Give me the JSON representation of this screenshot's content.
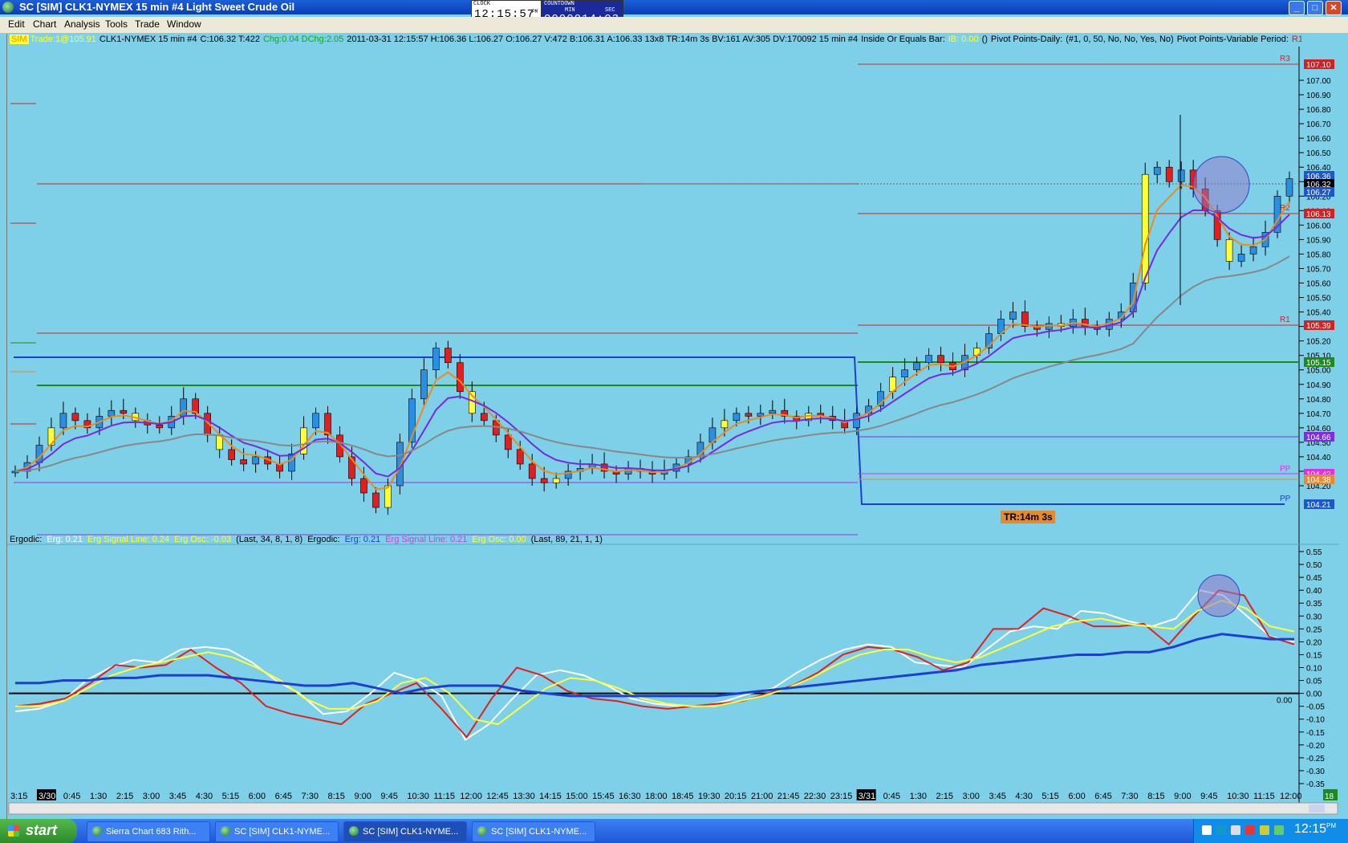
{
  "window": {
    "title": "SC [SIM] CLK1-NYMEX  15 min  #4  Light Sweet Crude Oil"
  },
  "clock": {
    "label": "CLOCK",
    "value": "12:15:57",
    "ampm": "PM"
  },
  "countdown": {
    "label": "COUNTDOWN",
    "min_label": "MIN",
    "sec_label": "SEC",
    "value": "0000014:03"
  },
  "menu": [
    "Edit",
    "Chart",
    "Analysis",
    "Tools",
    "Trade",
    "Window"
  ],
  "info_bar": {
    "sim": "SIM",
    "trade": "Trade:1@105.91",
    "symbol": "CLK1-NYMEX  15 min  #4",
    "ohlc": "C:106.32 T:422",
    "chg": "Chg:0.04 DChg:2.05",
    "detail": "2011-03-31 12:15:57 H:106.36 L:106.27 O:106.27 V:472 B:106.31 A:106.33 13x8 TR:14m 3s BV:161 AV:305 DV:170092 15 min  #4",
    "inside": "Inside Or Equals Bar:",
    "ib": "IB: 0.00",
    "parens": "()",
    "pivots_daily": "Pivot Points-Daily:",
    "pivots_params": "(#1, 0, 50, No, No, Yes, No)",
    "pivots_variable": "Pivot Points-Variable Period:",
    "r1_flag": "R1"
  },
  "ergodic_bar": {
    "ergodic1": "Ergodic:",
    "erg1": "Erg: 0.21",
    "sig1": "Erg Signal Line: 0.24",
    "osc1": "Erg Osc: -0.03",
    "params1": "(Last, 34, 8, 1, 8)",
    "ergodic2": "Ergodic:",
    "erg2": "Erg: 0.21",
    "sig2": "Erg Signal Line: 0.21",
    "osc2": "Erg Osc: 0.00",
    "params2": "(Last, 89, 21, 1, 1)"
  },
  "price_scale": [
    "107.00",
    "106.90",
    "106.80",
    "106.70",
    "106.60",
    "106.50",
    "106.40",
    "106.30",
    "106.20",
    "106.10",
    "106.00",
    "105.90",
    "105.80",
    "105.70",
    "105.60",
    "105.50",
    "105.40",
    "105.30",
    "105.20",
    "105.10",
    "105.00",
    "104.90",
    "104.80",
    "104.70",
    "104.60",
    "104.50",
    "104.40",
    "104.30",
    "104.20"
  ],
  "price_tags": [
    {
      "label": "107.10",
      "color": "#d42020"
    },
    {
      "label": "106.36",
      "color": "#1d57d0"
    },
    {
      "label": "106.32",
      "color": "#000000"
    },
    {
      "label": "106.27",
      "color": "#1d57d0"
    },
    {
      "label": "106.13",
      "color": "#d42020"
    },
    {
      "label": "105.39",
      "color": "#d42020"
    },
    {
      "label": "105.15",
      "color": "#1d8a1d"
    },
    {
      "label": "104.66",
      "color": "#7d2fe0"
    },
    {
      "label": "104.42",
      "color": "#e030e0"
    },
    {
      "label": "104.38",
      "color": "#e68a2e"
    },
    {
      "label": "104.21",
      "color": "#1d57d0"
    }
  ],
  "pivot_labels": {
    "r3": "R3",
    "r2": "R2",
    "r1": "R1",
    "pp_magenta": "PP",
    "pp_blue": "PP"
  },
  "tr_label": "TR:14m 3s",
  "osc_scale": [
    "0.55",
    "0.50",
    "0.45",
    "0.40",
    "0.35",
    "0.30",
    "0.25",
    "0.20",
    "0.15",
    "0.10",
    "0.05",
    "0.00",
    "-0.05",
    "-0.10",
    "-0.15",
    "-0.20",
    "-0.25",
    "-0.30",
    "-0.35"
  ],
  "osc_zero_tag": "0.00",
  "time_axis": [
    "3:15",
    "3/30",
    "0:45",
    "1:30",
    "2:15",
    "3:00",
    "3:45",
    "4:30",
    "5:15",
    "6:00",
    "6:45",
    "7:30",
    "8:15",
    "9:00",
    "9:45",
    "10:30",
    "11:15",
    "12:00",
    "12:45",
    "13:30",
    "14:15",
    "15:00",
    "15:45",
    "16:30",
    "18:00",
    "18:45",
    "19:30",
    "20:15",
    "21:00",
    "21:45",
    "22:30",
    "23:15",
    "3/31",
    "0:45",
    "1:30",
    "2:15",
    "3:00",
    "3:45",
    "4:30",
    "5:15",
    "6:00",
    "6:45",
    "7:30",
    "8:15",
    "9:00",
    "9:45",
    "10:30",
    "11:15",
    "12:00"
  ],
  "axis_corner": "18",
  "taskbar": {
    "start": "start",
    "tasks": [
      "Sierra Chart 683 Rith...",
      "SC [SIM] CLK1-NYME...",
      "SC [SIM] CLK1-NYME...",
      "SC [SIM] CLK1-NYME..."
    ],
    "clock": "12:15",
    "clock_ampm": "PM"
  },
  "colors": {
    "background": "#7ecfe8",
    "up_candle": "#2a8fe0",
    "down_candle": "#e02020",
    "inside_candle": "#ffff33",
    "ema_fast": "#f08a1a",
    "ema_mid": "#7a28e0",
    "ema_slow": "#888888"
  }
}
